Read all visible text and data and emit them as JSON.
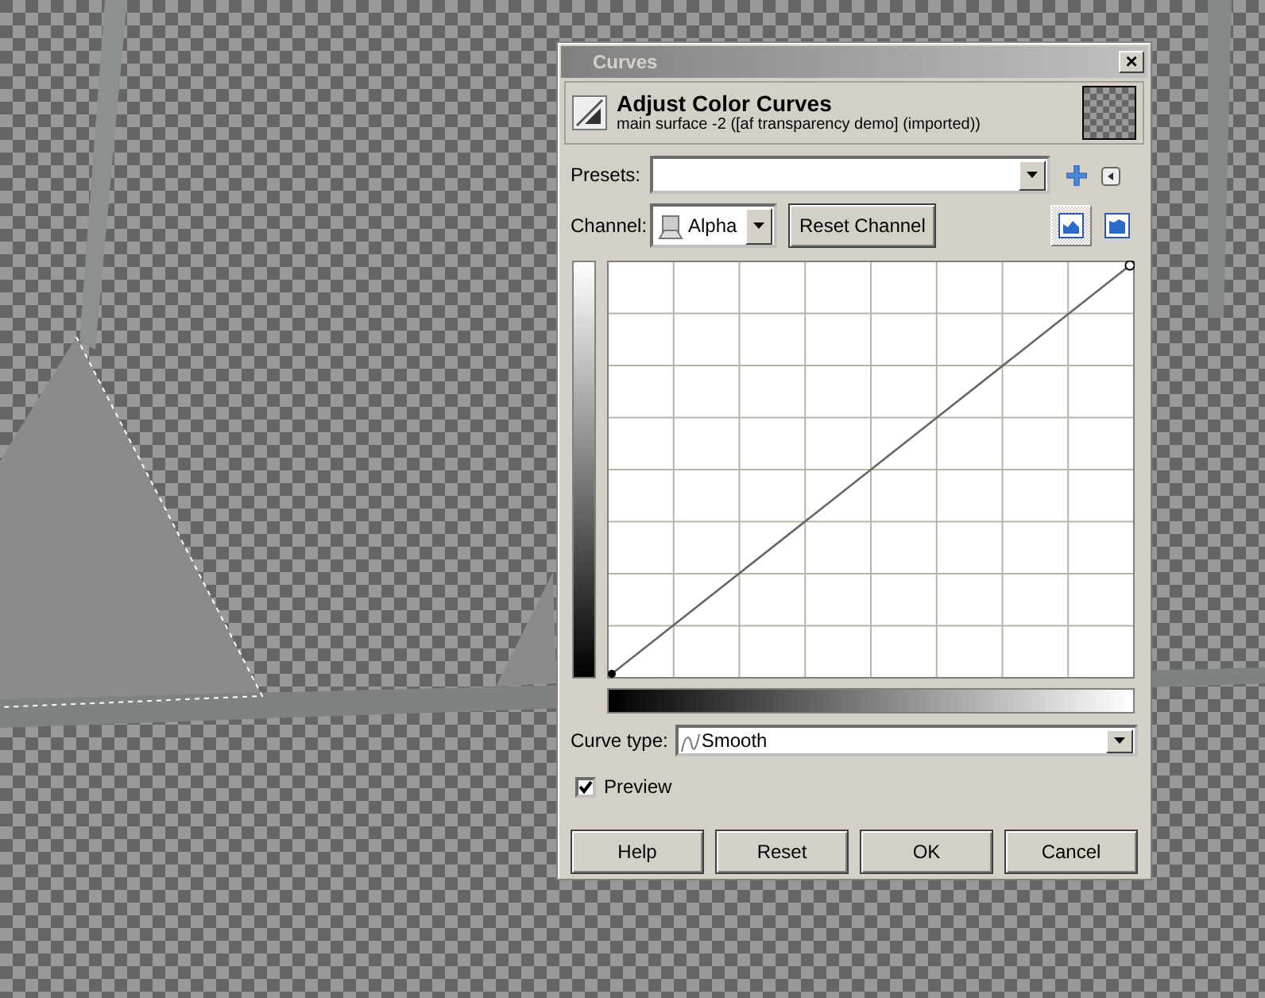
{
  "window": {
    "title": "Curves",
    "close": "×"
  },
  "header": {
    "title": "Adjust Color Curves",
    "subtitle": "main surface -2 ([af transparency demo] (imported))"
  },
  "presets": {
    "label": "Presets:"
  },
  "channel": {
    "label": "Channel:",
    "value": "Alpha",
    "reset": {
      "label": "Reset Channel"
    }
  },
  "histogram_modes": [
    {
      "kind": "linear",
      "selected": true
    },
    {
      "kind": "logarithmic",
      "selected": false
    }
  ],
  "curve_type": {
    "label": "Curve type:",
    "value": "Smooth"
  },
  "preview": {
    "label": "Preview",
    "checked": true
  },
  "buttons": [
    {
      "label": "Help"
    },
    {
      "label": "Reset"
    },
    {
      "label": "OK"
    },
    {
      "label": "Cancel"
    }
  ]
}
